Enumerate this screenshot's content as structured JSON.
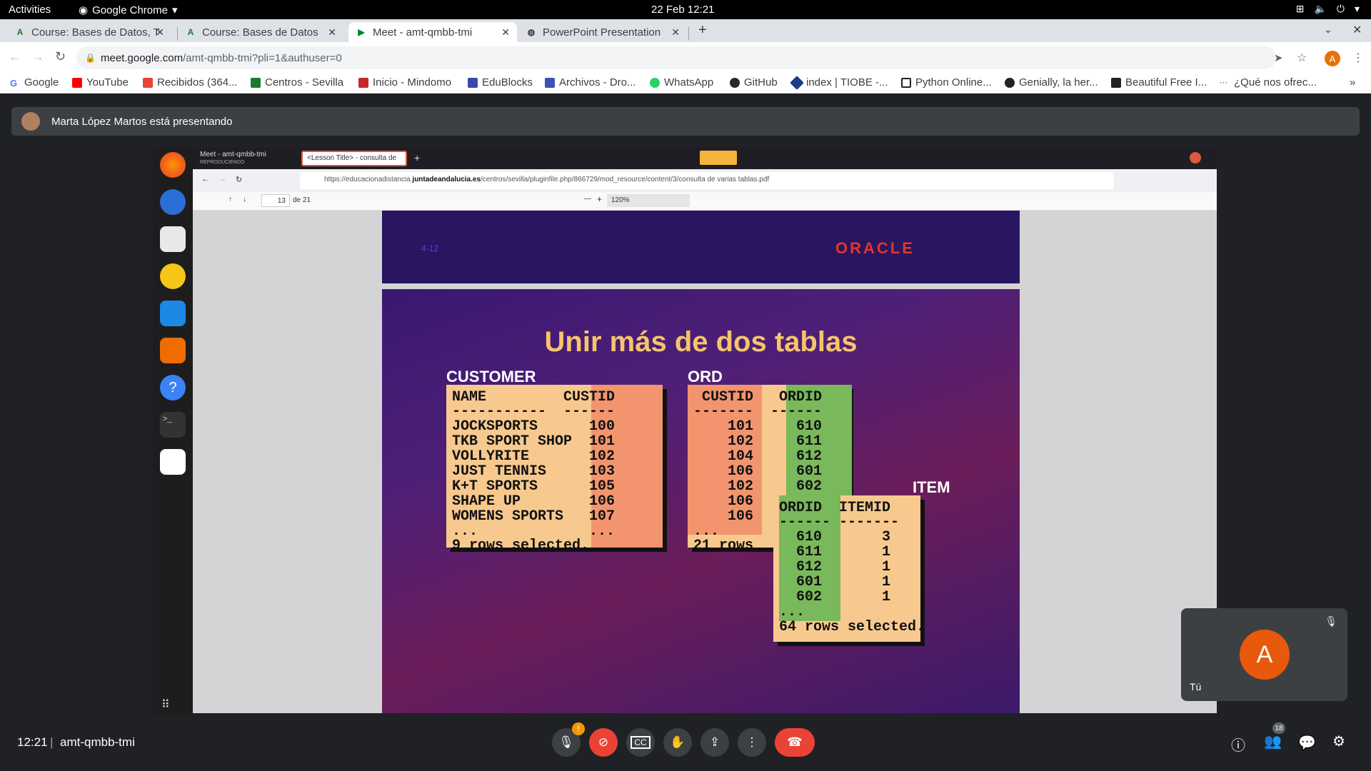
{
  "system": {
    "activities": "Activities",
    "app_name": "Google Chrome",
    "clock": "22 Feb 12:21"
  },
  "tabs": [
    {
      "title": "Course: Bases de Datos, T",
      "favicon": "course-icon"
    },
    {
      "title": "Course: Bases de Datos",
      "favicon": "course-icon"
    },
    {
      "title": "Meet - amt-qmbb-tmi",
      "favicon": "meet-icon",
      "active": true
    },
    {
      "title": "PowerPoint Presentation",
      "favicon": "globe-icon"
    }
  ],
  "address": {
    "host": "meet.google.com",
    "path": "/amt-qmbb-tmi?pli=1&authuser=0"
  },
  "profile_initial": "A",
  "bookmarks": [
    "Google",
    "YouTube",
    "Recibidos (364...",
    "Centros - Sevilla",
    "Inicio - Mindomo",
    "EduBlocks",
    "Archivos - Dro...",
    "WhatsApp",
    "GitHub",
    "index | TIOBE -...",
    "Python Online...",
    "Genially, la her...",
    "Beautiful Free I...",
    "¿Qué nos ofrec..."
  ],
  "meet": {
    "presenter_text": "Marta López Martos está presentando",
    "time": "12:21",
    "meeting_code": "amt-qmbb-tmi",
    "participants_count": "18",
    "self_label": "Tú",
    "self_initial": "A"
  },
  "shared_screen": {
    "tab1_title": "Meet - amt-qmbb-tmi",
    "tab1_sub": "REPRODUCIENDO",
    "tab2_title": "<Lesson Title> - consulta de",
    "url_pre": "https://educacionadistancia.",
    "url_host": "juntadeandalucia.es",
    "url_rest": "/centros/sevilla/pluginfile.php/866729/mod_resource/content/3/consulta de varias tablas.pdf",
    "page_num": "13",
    "page_of": "de 21",
    "zoom": "120%"
  },
  "slide_prev": {
    "page_label": "4-12",
    "logo": "ORACLE"
  },
  "slide": {
    "title": "Unir más de dos tablas",
    "customer_label": "CUSTOMER",
    "ord_label": "ORD",
    "item_label": "ITEM",
    "customer_header": "NAME         CUSTID",
    "customer_sep": "-----------  ------",
    "customer_rows": [
      "JOCKSPORTS      100",
      "TKB SPORT SHOP  101",
      "VOLLYRITE       102",
      "JUST TENNIS     103",
      "K+T SPORTS      105",
      "SHAPE UP        106",
      "WOMENS SPORTS   107",
      "...             ..."
    ],
    "customer_footer": "9 rows selected.",
    "ord_header": " CUSTID   ORDID",
    "ord_sep": "-------  ------",
    "ord_rows": [
      "    101     610",
      "    102     611",
      "    104     612",
      "    106     601",
      "    102     602",
      "    106     ...",
      "    106     ...",
      "..."
    ],
    "ord_footer": "21 rows",
    "item_header": "ORDID  ITEMID",
    "item_sep": "------ -------",
    "item_rows": [
      "  610       3",
      "  611       1",
      "  612       1",
      "  601       1",
      "  602       1",
      "..."
    ],
    "item_footer": "64 rows selected."
  }
}
